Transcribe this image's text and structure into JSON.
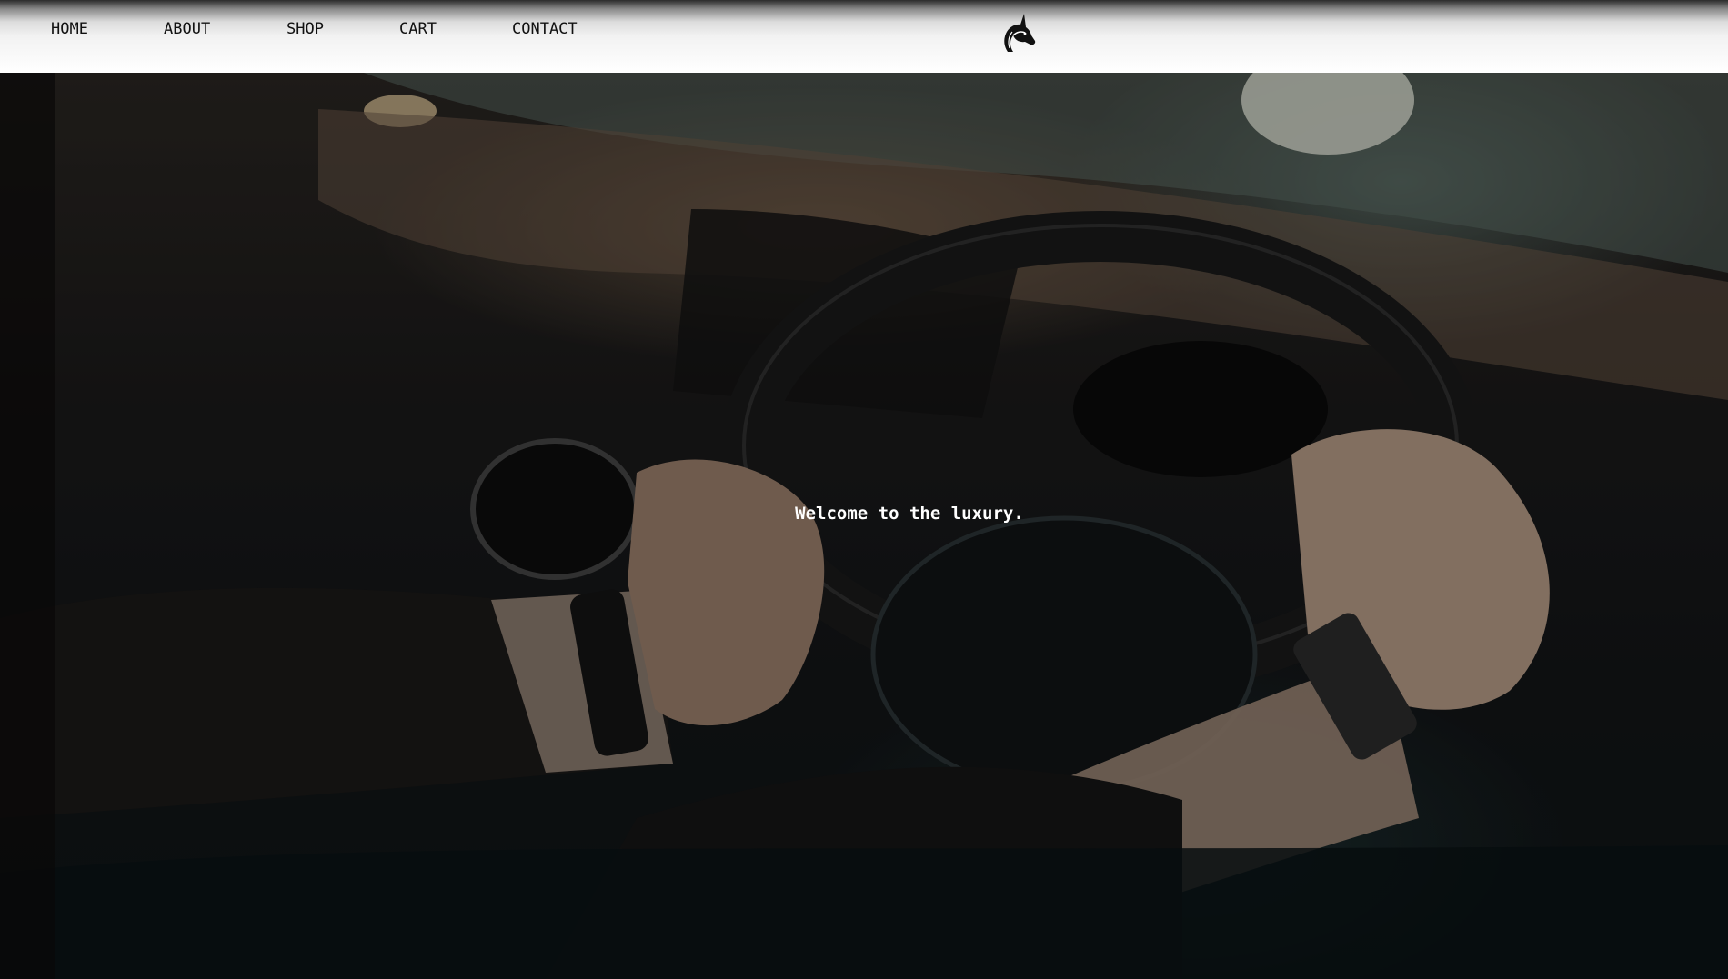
{
  "nav": {
    "items": [
      {
        "label": "HOME"
      },
      {
        "label": "ABOUT"
      },
      {
        "label": "SHOP"
      },
      {
        "label": "CART"
      },
      {
        "label": "CONTACT"
      }
    ]
  },
  "logo": {
    "icon": "unicorn-head-logo-icon"
  },
  "hero": {
    "tagline": "Welcome to the luxury."
  },
  "colors": {
    "nav_text": "#111111",
    "tagline": "#ffffff"
  }
}
